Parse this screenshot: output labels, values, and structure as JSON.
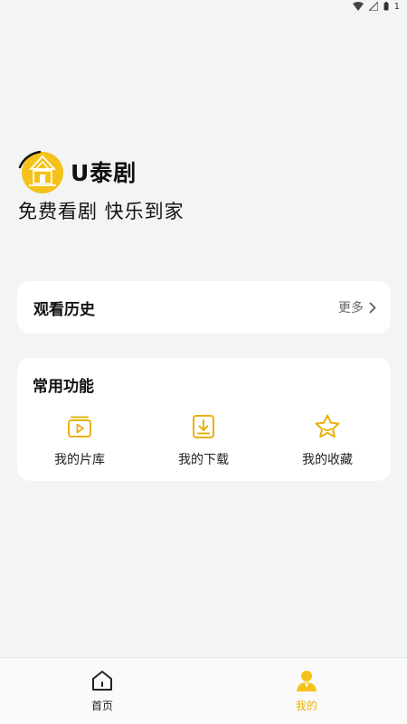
{
  "status_bar": {
    "battery_text": "1"
  },
  "brand": {
    "name": "U泰剧",
    "slogan": "免费看剧 快乐到家"
  },
  "history": {
    "title": "观看历史",
    "more_label": "更多"
  },
  "functions": {
    "title": "常用功能",
    "items": [
      {
        "label": "我的片库",
        "icon": "video-library-icon"
      },
      {
        "label": "我的下载",
        "icon": "download-icon"
      },
      {
        "label": "我的收藏",
        "icon": "star-icon"
      }
    ]
  },
  "tab_bar": {
    "tabs": [
      {
        "label": "首页",
        "icon": "home-icon",
        "active": false
      },
      {
        "label": "我的",
        "icon": "user-icon",
        "active": true
      }
    ]
  },
  "colors": {
    "accent": "#f5c21b",
    "background": "#f2f5f4",
    "card": "#ffffff"
  }
}
